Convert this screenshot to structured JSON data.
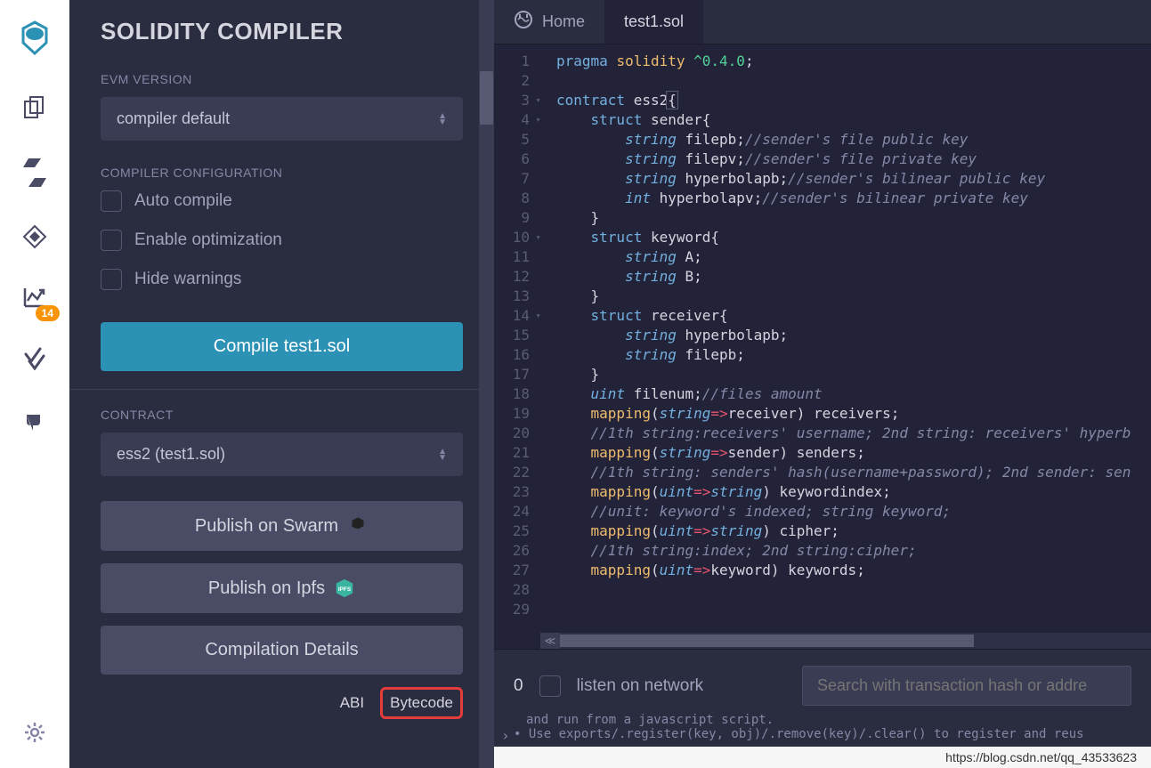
{
  "panel": {
    "title": "SOLIDITY COMPILER",
    "evm_label": "EVM VERSION",
    "evm_value": "compiler default",
    "config_label": "COMPILER CONFIGURATION",
    "auto_compile": "Auto compile",
    "enable_opt": "Enable optimization",
    "hide_warn": "Hide warnings",
    "compile_btn": "Compile test1.sol",
    "contract_label": "CONTRACT",
    "contract_value": "ess2 (test1.sol)",
    "publish_swarm": "Publish on Swarm",
    "publish_ipfs": "Publish on Ipfs",
    "compilation_details": "Compilation Details",
    "abi_link": "ABI",
    "bytecode_link": "Bytecode"
  },
  "iconbar": {
    "badge": "14"
  },
  "tabs": {
    "home": "Home",
    "file": "test1.sol"
  },
  "bottom": {
    "count": "0",
    "listen": "listen on network",
    "search_placeholder": "Search with transaction hash or addre",
    "console1": "and run from a javascript script.",
    "console2": "Use exports/.register(key, obj)/.remove(key)/.clear() to register and reus"
  },
  "status_url": "https://blog.csdn.net/qq_43533623",
  "code": {
    "lines": [
      {
        "n": 1,
        "fold": false
      },
      {
        "n": 2,
        "fold": false
      },
      {
        "n": 3,
        "fold": true
      },
      {
        "n": 4,
        "fold": true
      },
      {
        "n": 5,
        "fold": false
      },
      {
        "n": 6,
        "fold": false
      },
      {
        "n": 7,
        "fold": false
      },
      {
        "n": 8,
        "fold": false
      },
      {
        "n": 9,
        "fold": false
      },
      {
        "n": 10,
        "fold": true
      },
      {
        "n": 11,
        "fold": false
      },
      {
        "n": 12,
        "fold": false
      },
      {
        "n": 13,
        "fold": false
      },
      {
        "n": 14,
        "fold": true
      },
      {
        "n": 15,
        "fold": false
      },
      {
        "n": 16,
        "fold": false
      },
      {
        "n": 17,
        "fold": false
      },
      {
        "n": 18,
        "fold": false
      },
      {
        "n": 19,
        "fold": false
      },
      {
        "n": 20,
        "fold": false
      },
      {
        "n": 21,
        "fold": false
      },
      {
        "n": 22,
        "fold": false
      },
      {
        "n": 23,
        "fold": false
      },
      {
        "n": 24,
        "fold": false
      },
      {
        "n": 25,
        "fold": false
      },
      {
        "n": 26,
        "fold": false
      },
      {
        "n": 27,
        "fold": false
      },
      {
        "n": 28,
        "fold": false
      },
      {
        "n": 29,
        "fold": false
      }
    ],
    "source": [
      [
        [
          "kw",
          "pragma"
        ],
        [
          "sp",
          " "
        ],
        [
          "kw2",
          "solidity"
        ],
        [
          "sp",
          " "
        ],
        [
          "ver",
          "^0.4.0"
        ],
        [
          "punc",
          ";"
        ]
      ],
      [],
      [
        [
          "kw",
          "contract"
        ],
        [
          "sp",
          " "
        ],
        [
          "id",
          "ess2"
        ],
        [
          "hl",
          "{"
        ]
      ],
      [
        [
          "sp",
          "    "
        ],
        [
          "kw",
          "struct"
        ],
        [
          "sp",
          " "
        ],
        [
          "id",
          "sender"
        ],
        [
          "punc",
          "{"
        ]
      ],
      [
        [
          "sp",
          "        "
        ],
        [
          "type",
          "string"
        ],
        [
          "sp",
          " "
        ],
        [
          "id",
          "filepb"
        ],
        [
          "punc",
          ";"
        ],
        [
          "com",
          "//sender's file public key"
        ]
      ],
      [
        [
          "sp",
          "        "
        ],
        [
          "type",
          "string"
        ],
        [
          "sp",
          " "
        ],
        [
          "id",
          "filepv"
        ],
        [
          "punc",
          ";"
        ],
        [
          "com",
          "//sender's file private key"
        ]
      ],
      [
        [
          "sp",
          "        "
        ],
        [
          "type",
          "string"
        ],
        [
          "sp",
          " "
        ],
        [
          "id",
          "hyperbolapb"
        ],
        [
          "punc",
          ";"
        ],
        [
          "com",
          "//sender's bilinear public key"
        ]
      ],
      [
        [
          "sp",
          "        "
        ],
        [
          "type",
          "int"
        ],
        [
          "sp",
          " "
        ],
        [
          "id",
          "hyperbolapv"
        ],
        [
          "punc",
          ";"
        ],
        [
          "com",
          "//sender's bilinear private key"
        ]
      ],
      [
        [
          "sp",
          "    "
        ],
        [
          "punc",
          "}"
        ]
      ],
      [
        [
          "sp",
          "    "
        ],
        [
          "kw",
          "struct"
        ],
        [
          "sp",
          " "
        ],
        [
          "id",
          "keyword"
        ],
        [
          "punc",
          "{"
        ]
      ],
      [
        [
          "sp",
          "        "
        ],
        [
          "type",
          "string"
        ],
        [
          "sp",
          " "
        ],
        [
          "id",
          "A"
        ],
        [
          "punc",
          ";"
        ]
      ],
      [
        [
          "sp",
          "        "
        ],
        [
          "type",
          "string"
        ],
        [
          "sp",
          " "
        ],
        [
          "id",
          "B"
        ],
        [
          "punc",
          ";"
        ]
      ],
      [
        [
          "sp",
          "    "
        ],
        [
          "punc",
          "}"
        ]
      ],
      [
        [
          "sp",
          "    "
        ],
        [
          "kw",
          "struct"
        ],
        [
          "sp",
          " "
        ],
        [
          "id",
          "receiver"
        ],
        [
          "punc",
          "{"
        ]
      ],
      [
        [
          "sp",
          "        "
        ],
        [
          "type",
          "string"
        ],
        [
          "sp",
          " "
        ],
        [
          "id",
          "hyperbolapb"
        ],
        [
          "punc",
          ";"
        ]
      ],
      [
        [
          "sp",
          "        "
        ],
        [
          "type",
          "string"
        ],
        [
          "sp",
          " "
        ],
        [
          "id",
          "filepb"
        ],
        [
          "punc",
          ";"
        ]
      ],
      [
        [
          "sp",
          "    "
        ],
        [
          "punc",
          "}"
        ]
      ],
      [
        [
          "sp",
          "    "
        ],
        [
          "type",
          "uint"
        ],
        [
          "sp",
          " "
        ],
        [
          "id",
          "filenum"
        ],
        [
          "punc",
          ";"
        ],
        [
          "com",
          "//files amount"
        ]
      ],
      [
        [
          "sp",
          "    "
        ],
        [
          "kw2",
          "mapping"
        ],
        [
          "punc",
          "("
        ],
        [
          "type",
          "string"
        ],
        [
          "op",
          "=>"
        ],
        [
          "id",
          "receiver"
        ],
        [
          "punc",
          ")"
        ],
        [
          "sp",
          " "
        ],
        [
          "id",
          "receivers"
        ],
        [
          "punc",
          ";"
        ]
      ],
      [
        [
          "sp",
          "    "
        ],
        [
          "com",
          "//1th string:receivers' username; 2nd string: receivers' hyperb"
        ]
      ],
      [
        [
          "sp",
          "    "
        ],
        [
          "kw2",
          "mapping"
        ],
        [
          "punc",
          "("
        ],
        [
          "type",
          "string"
        ],
        [
          "op",
          "=>"
        ],
        [
          "id",
          "sender"
        ],
        [
          "punc",
          ")"
        ],
        [
          "sp",
          " "
        ],
        [
          "id",
          "senders"
        ],
        [
          "punc",
          ";"
        ]
      ],
      [
        [
          "sp",
          "    "
        ],
        [
          "com",
          "//1th string: senders' hash(username+password); 2nd sender: sen"
        ]
      ],
      [
        [
          "sp",
          "    "
        ],
        [
          "kw2",
          "mapping"
        ],
        [
          "punc",
          "("
        ],
        [
          "type",
          "uint"
        ],
        [
          "op",
          "=>"
        ],
        [
          "type",
          "string"
        ],
        [
          "punc",
          ")"
        ],
        [
          "sp",
          " "
        ],
        [
          "id",
          "keywordindex"
        ],
        [
          "punc",
          ";"
        ]
      ],
      [
        [
          "sp",
          "    "
        ],
        [
          "com",
          "//unit: keyword's indexed; string keyword;"
        ]
      ],
      [
        [
          "sp",
          "    "
        ],
        [
          "kw2",
          "mapping"
        ],
        [
          "punc",
          "("
        ],
        [
          "type",
          "uint"
        ],
        [
          "op",
          "=>"
        ],
        [
          "type",
          "string"
        ],
        [
          "punc",
          ")"
        ],
        [
          "sp",
          " "
        ],
        [
          "id",
          "cipher"
        ],
        [
          "punc",
          ";"
        ]
      ],
      [
        [
          "sp",
          "    "
        ],
        [
          "com",
          "//1th string:index; 2nd string:cipher;"
        ]
      ],
      [
        [
          "sp",
          "    "
        ],
        [
          "kw2",
          "mapping"
        ],
        [
          "punc",
          "("
        ],
        [
          "type",
          "uint"
        ],
        [
          "op",
          "=>"
        ],
        [
          "id",
          "keyword"
        ],
        [
          "punc",
          ")"
        ],
        [
          "sp",
          " "
        ],
        [
          "id",
          "keywords"
        ],
        [
          "punc",
          ";"
        ]
      ],
      [],
      []
    ]
  }
}
